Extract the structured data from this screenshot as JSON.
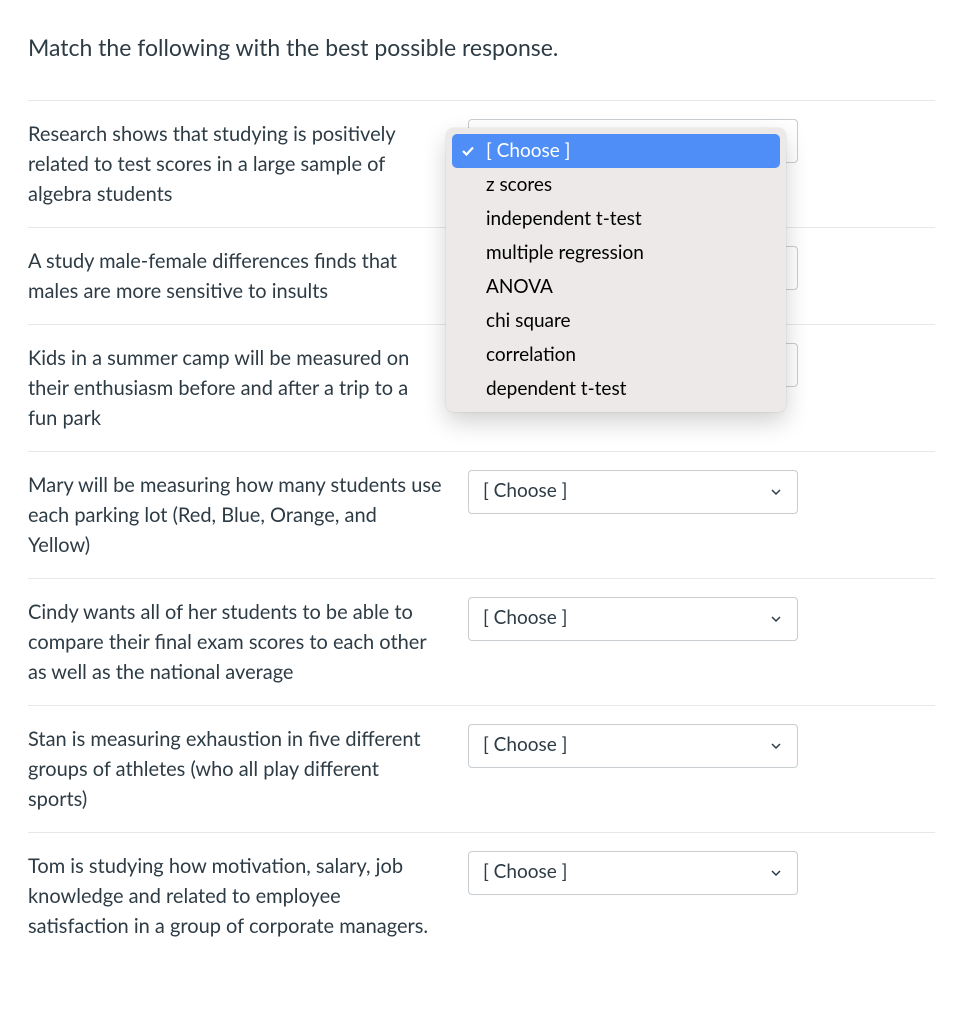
{
  "question_stem": "Match the following with the best possible response.",
  "placeholder": "[ Choose ]",
  "prompts": [
    "Research shows that studying is positively related to test scores in a large sample of algebra students",
    "A study male-female differences finds that males are more sensitive to insults",
    "Kids in a summer camp will be measured on their enthusiasm before and after a trip to a fun park",
    "Mary will be measuring how many students use each parking lot (Red, Blue, Orange, and Yellow)",
    "Cindy wants all of her students to be able to compare their final exam scores to each other as well as the national average",
    "Stan is measuring exhaustion in five different groups of athletes (who all play different sports)",
    "Tom is studying how motivation, salary, job knowledge and related to employee satisfaction in a group of corporate managers."
  ],
  "dropdown": {
    "selected_index": 0,
    "options": [
      "[ Choose ]",
      "z scores",
      "independent t-test",
      "multiple regression",
      "ANOVA",
      "chi square",
      "correlation",
      "dependent t-test"
    ]
  }
}
